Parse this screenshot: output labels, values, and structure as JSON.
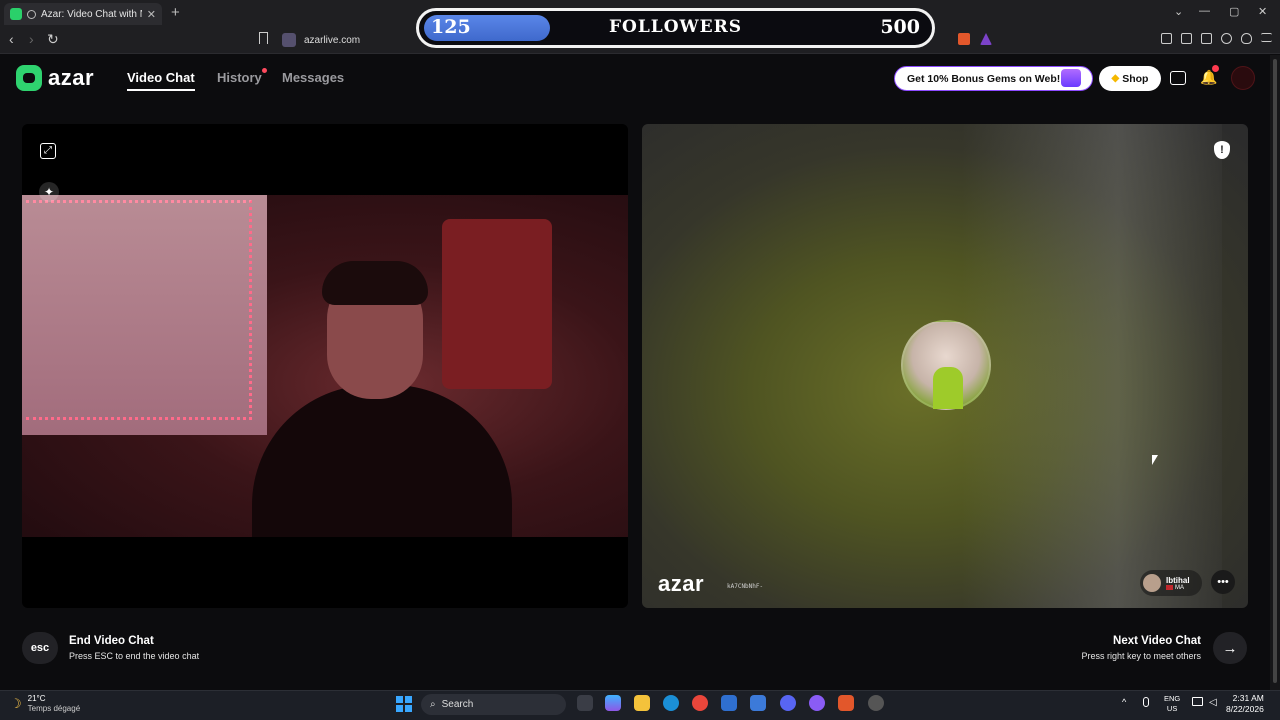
{
  "browser": {
    "tab_title": "Azar: Video Chat with New Pe",
    "tab_close": "✕",
    "new_tab": "+",
    "url": "azarlive.com",
    "back": "‹",
    "forward": "›",
    "reload": "↻",
    "min": "—",
    "max": "▢",
    "close": "✕",
    "chevron": "⌄"
  },
  "followers": {
    "current": "125",
    "label": "FOLLOWERS",
    "goal": "500",
    "progress": 0.25
  },
  "header": {
    "logo_text": "azar",
    "nav": [
      {
        "label": "Video Chat",
        "active": true
      },
      {
        "label": "History",
        "active": false
      },
      {
        "label": "Messages",
        "active": false
      }
    ],
    "promo": "Get 10% Bonus Gems on Web!",
    "shop_gem": "◆",
    "shop": "Shop",
    "notification_count": "1"
  },
  "left_video": {
    "expand_icon": "⤢",
    "wand_icon": "✦"
  },
  "right_video": {
    "report_icon": "!",
    "watermark": "azar",
    "watermark_code": "kA7CNbNhF-",
    "peer_name": "Ibtihal",
    "peer_country": "MA",
    "chat_icon": "•••"
  },
  "controls": {
    "esc_label": "esc",
    "end_title": "End Video Chat",
    "end_sub": "Press ESC to end the video chat",
    "next_title": "Next Video Chat",
    "next_sub": "Press right key to meet others",
    "next_arrow": "→"
  },
  "taskbar": {
    "weather_temp": "21°C",
    "weather_desc": "Temps dégagé",
    "weather_icon": "☽",
    "search": "Search",
    "search_icon": "⌕",
    "lang1": "ENG",
    "lang2": "US",
    "time": "2:31 AM",
    "date": "8/22/2026",
    "tray_up": "^"
  },
  "colors": {
    "accent": "#2fd36f",
    "followers_fill": "#4a76d8",
    "promo_border": "#8c4bff"
  }
}
